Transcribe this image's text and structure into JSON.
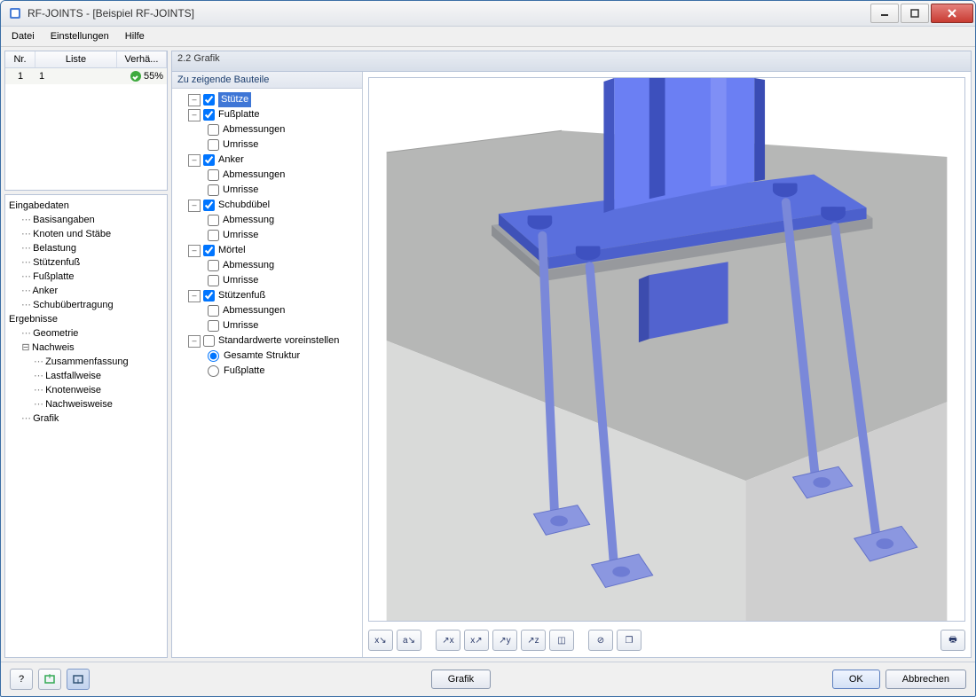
{
  "window": {
    "title": "RF-JOINTS - [Beispiel RF-JOINTS]"
  },
  "menu": {
    "file": "Datei",
    "settings": "Einstellungen",
    "help": "Hilfe"
  },
  "grid": {
    "col_nr": "Nr.",
    "col_list": "Liste",
    "col_ratio": "Verhä...",
    "row1_nr": "1",
    "row1_list": "1",
    "row1_ratio": "55%"
  },
  "nav": {
    "eingabe": "Eingabedaten",
    "basis": "Basisangaben",
    "knoten": "Knoten und Stäbe",
    "belastung": "Belastung",
    "stuetzenfuss": "Stützenfuß",
    "fussplatte": "Fußplatte",
    "anker": "Anker",
    "schub": "Schubübertragung",
    "ergebnisse": "Ergebnisse",
    "geometrie": "Geometrie",
    "nachweis": "Nachweis",
    "zusammen": "Zusammenfassung",
    "lastfall": "Lastfallweise",
    "knotenw": "Knotenweise",
    "nachww": "Nachweisweise",
    "grafik": "Grafik"
  },
  "panel": {
    "title": "2.2 Grafik",
    "comp_head": "Zu zeigende Bauteile",
    "stuetze": "Stütze",
    "fussplatte": "Fußplatte",
    "abm": "Abmessungen",
    "abm1": "Abmessung",
    "umrisse": "Umrisse",
    "anker": "Anker",
    "schubd": "Schubdübel",
    "moertel": "Mörtel",
    "stuetzenfuss": "Stützenfuß",
    "std": "Standardwerte voreinstellen",
    "ges": "Gesamte Struktur",
    "fp": "Fußplatte"
  },
  "toolbar": {
    "b1": "x↘",
    "b2": "a↘",
    "b3": "↗x",
    "b4": "x↗",
    "b5": "↗y",
    "b6": "↗z",
    "b7": "◫",
    "b8": "⊘",
    "b9": "❐",
    "print": "🖶"
  },
  "footer": {
    "help": "?",
    "grafik": "Grafik",
    "ok": "OK",
    "cancel": "Abbrechen"
  }
}
